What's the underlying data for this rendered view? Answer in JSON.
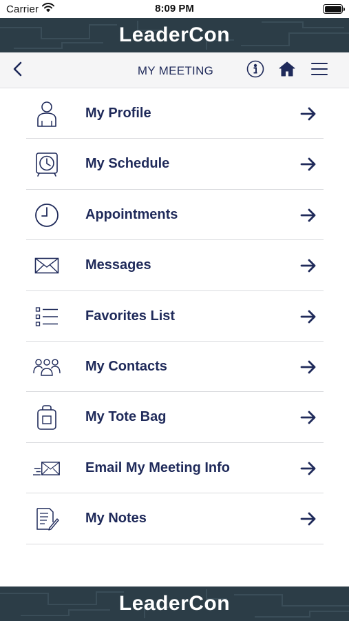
{
  "status_bar": {
    "carrier": "Carrier",
    "time": "8:09 PM",
    "battery_level": 1.0
  },
  "brand": {
    "name": "LeaderCon",
    "bar_color": "#2c3d47",
    "text_color": "#ffffff"
  },
  "nav": {
    "title": "MY MEETING",
    "back_icon": "chevron-left-icon",
    "info_icon": "info-icon",
    "home_icon": "home-icon",
    "menu_icon": "hamburger-menu-icon"
  },
  "menu": {
    "accent_color": "#1f2a5a",
    "items": [
      {
        "label": "My Profile",
        "icon": "person-icon"
      },
      {
        "label": "My Schedule",
        "icon": "alarm-clock-icon"
      },
      {
        "label": "Appointments",
        "icon": "clock-icon"
      },
      {
        "label": "Messages",
        "icon": "envelope-icon"
      },
      {
        "label": "Favorites List",
        "icon": "checklist-icon"
      },
      {
        "label": "My Contacts",
        "icon": "group-icon"
      },
      {
        "label": "My Tote Bag",
        "icon": "bag-icon"
      },
      {
        "label": "Email My Meeting Info",
        "icon": "send-mail-icon"
      },
      {
        "label": "My Notes",
        "icon": "notes-icon"
      }
    ]
  }
}
